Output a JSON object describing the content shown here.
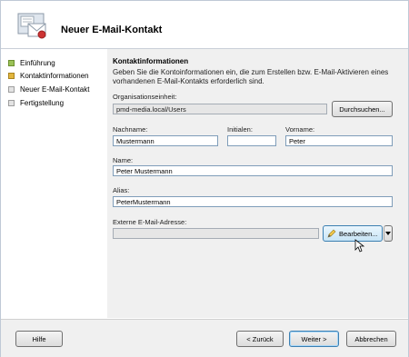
{
  "window": {
    "title": "Neuer E-Mail-Kontakt"
  },
  "steps": [
    {
      "label": "Einführung",
      "state": "done"
    },
    {
      "label": "Kontaktinformationen",
      "state": "current"
    },
    {
      "label": "Neuer E-Mail-Kontakt",
      "state": "pending"
    },
    {
      "label": "Fertigstellung",
      "state": "pending"
    }
  ],
  "content": {
    "title": "Kontaktinformationen",
    "description": "Geben Sie die Kontoinformationen ein, die zum Erstellen bzw. E-Mail-Aktivieren eines vorhandenen E-Mail-Kontakts erforderlich sind.",
    "ou_label": "Organisationseinheit:",
    "ou_value": "pmd-media.local/Users",
    "browse_label": "Durchsuchen...",
    "lastname_label": "Nachname:",
    "lastname_value": "Mustermann",
    "initials_label": "Initialen:",
    "initials_value": "",
    "firstname_label": "Vorname:",
    "firstname_value": "Peter",
    "name_label": "Name:",
    "name_value": "Peter Mustermann",
    "alias_label": "Alias:",
    "alias_value": "PeterMustermann",
    "external_label": "Externe E-Mail-Adresse:",
    "external_value": "",
    "edit_label": "Bearbeiten..."
  },
  "footer": {
    "help_label": "Hilfe",
    "back_label": "< Zurück",
    "next_label": "Weiter >",
    "cancel_label": "Abbrechen"
  },
  "colors": {
    "step_done": "#9bc257",
    "step_current": "#e2b63d",
    "step_pending": "#e3e3e3"
  }
}
